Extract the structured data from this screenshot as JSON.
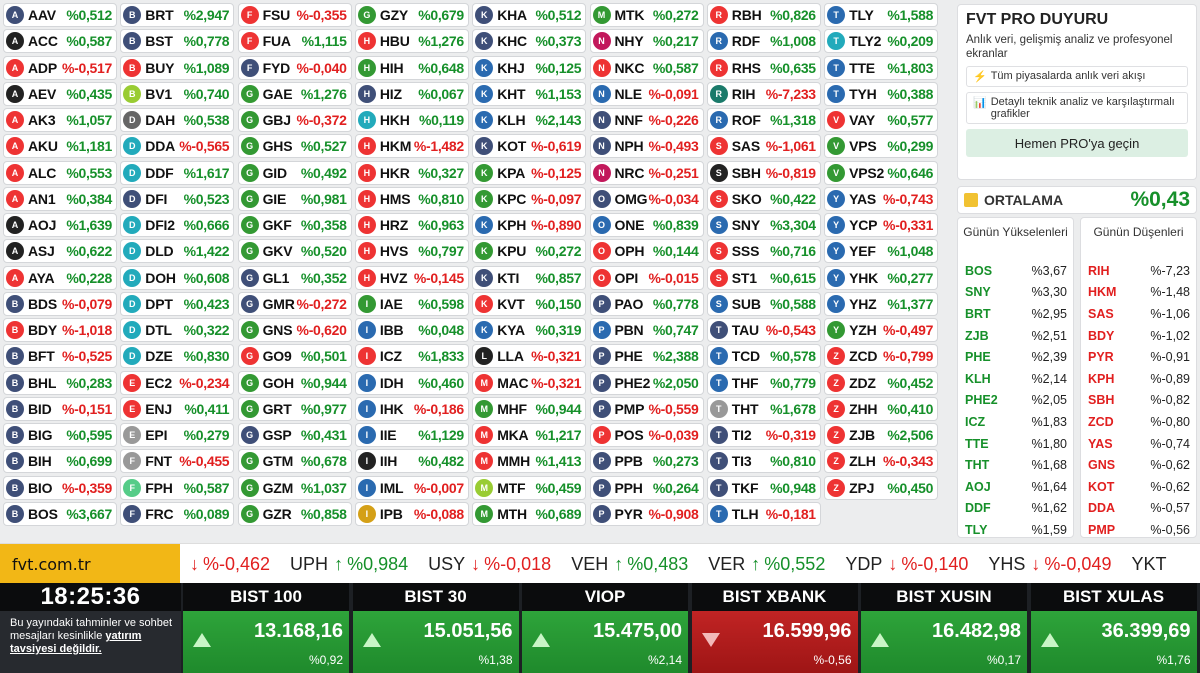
{
  "stocks": [
    [
      [
        "AAV",
        "%0,512",
        "up",
        "#3f4f78"
      ],
      [
        "ACC",
        "%0,587",
        "up",
        "#222"
      ],
      [
        "ADP",
        "%-0,517",
        "dn",
        "#e33"
      ],
      [
        "AEV",
        "%0,435",
        "up",
        "#222"
      ],
      [
        "AK3",
        "%1,057",
        "up",
        "#e33"
      ],
      [
        "AKU",
        "%1,181",
        "up",
        "#e33"
      ],
      [
        "ALC",
        "%0,553",
        "up",
        "#e33"
      ],
      [
        "AN1",
        "%0,384",
        "up",
        "#e33"
      ],
      [
        "AOJ",
        "%1,639",
        "up",
        "#222"
      ],
      [
        "ASJ",
        "%0,622",
        "up",
        "#222"
      ],
      [
        "AYA",
        "%0,228",
        "up",
        "#e33"
      ],
      [
        "BDS",
        "%-0,079",
        "dn",
        "#3f4f78"
      ],
      [
        "BDY",
        "%-1,018",
        "dn",
        "#e33"
      ],
      [
        "BFT",
        "%-0,525",
        "dn",
        "#3f4f78"
      ],
      [
        "BHL",
        "%0,283",
        "up",
        "#3f4f78"
      ],
      [
        "BID",
        "%-0,151",
        "dn",
        "#3f4f78"
      ],
      [
        "BIG",
        "%0,595",
        "up",
        "#3f4f78"
      ],
      [
        "BIH",
        "%0,699",
        "up",
        "#3f4f78"
      ],
      [
        "BIO",
        "%-0,359",
        "dn",
        "#3f4f78"
      ],
      [
        "BOS",
        "%3,667",
        "up",
        "#3f4f78"
      ]
    ],
    [
      [
        "BRT",
        "%2,947",
        "up",
        "#3f4f78"
      ],
      [
        "BST",
        "%0,778",
        "up",
        "#3f4f78"
      ],
      [
        "BUY",
        "%1,089",
        "up",
        "#e33"
      ],
      [
        "BV1",
        "%0,740",
        "up",
        "#9c3"
      ],
      [
        "DAH",
        "%0,538",
        "up",
        "#666"
      ],
      [
        "DDA",
        "%-0,565",
        "dn",
        "#2ab"
      ],
      [
        "DDF",
        "%1,617",
        "up",
        "#2ab"
      ],
      [
        "DFI",
        "%0,523",
        "up",
        "#3f4f78"
      ],
      [
        "DFI2",
        "%0,666",
        "up",
        "#2ab"
      ],
      [
        "DLD",
        "%1,422",
        "up",
        "#2ab"
      ],
      [
        "DOH",
        "%0,608",
        "up",
        "#2ab"
      ],
      [
        "DPT",
        "%0,423",
        "up",
        "#2ab"
      ],
      [
        "DTL",
        "%0,322",
        "up",
        "#2ab"
      ],
      [
        "DZE",
        "%0,830",
        "up",
        "#2ab"
      ],
      [
        "EC2",
        "%-0,234",
        "dn",
        "#e33"
      ],
      [
        "ENJ",
        "%0,411",
        "up",
        "#e33"
      ],
      [
        "EPI",
        "%0,279",
        "up",
        "#999"
      ],
      [
        "FNT",
        "%-0,455",
        "dn",
        "#999"
      ],
      [
        "FPH",
        "%0,587",
        "up",
        "#5c8"
      ],
      [
        "FRC",
        "%0,089",
        "up",
        "#3f4f78"
      ]
    ],
    [
      [
        "FSU",
        "%-0,355",
        "dn",
        "#e33"
      ],
      [
        "FUA",
        "%1,115",
        "up",
        "#e33"
      ],
      [
        "FYD",
        "%-0,040",
        "dn",
        "#3f4f78"
      ],
      [
        "GAE",
        "%1,276",
        "up",
        "#393"
      ],
      [
        "GBJ",
        "%-0,372",
        "dn",
        "#393"
      ],
      [
        "GHS",
        "%0,527",
        "up",
        "#393"
      ],
      [
        "GID",
        "%0,492",
        "up",
        "#393"
      ],
      [
        "GIE",
        "%0,981",
        "up",
        "#393"
      ],
      [
        "GKF",
        "%0,358",
        "up",
        "#393"
      ],
      [
        "GKV",
        "%0,520",
        "up",
        "#393"
      ],
      [
        "GL1",
        "%0,352",
        "up",
        "#3f4f78"
      ],
      [
        "GMR",
        "%-0,272",
        "dn",
        "#3f4f78"
      ],
      [
        "GNS",
        "%-0,620",
        "dn",
        "#393"
      ],
      [
        "GO9",
        "%0,501",
        "up",
        "#e33"
      ],
      [
        "GOH",
        "%0,944",
        "up",
        "#393"
      ],
      [
        "GRT",
        "%0,977",
        "up",
        "#393"
      ],
      [
        "GSP",
        "%0,431",
        "up",
        "#3f4f78"
      ],
      [
        "GTM",
        "%0,678",
        "up",
        "#393"
      ],
      [
        "GZM",
        "%1,037",
        "up",
        "#393"
      ],
      [
        "GZR",
        "%0,858",
        "up",
        "#393"
      ]
    ],
    [
      [
        "GZY",
        "%0,679",
        "up",
        "#393"
      ],
      [
        "HBU",
        "%1,276",
        "up",
        "#e33"
      ],
      [
        "HIH",
        "%0,648",
        "up",
        "#393"
      ],
      [
        "HIZ",
        "%0,067",
        "up",
        "#3f4f78"
      ],
      [
        "HKH",
        "%0,119",
        "up",
        "#2ab"
      ],
      [
        "HKM",
        "%-1,482",
        "dn",
        "#e33"
      ],
      [
        "HKR",
        "%0,327",
        "up",
        "#e33"
      ],
      [
        "HMS",
        "%0,810",
        "up",
        "#e33"
      ],
      [
        "HRZ",
        "%0,963",
        "up",
        "#e33"
      ],
      [
        "HVS",
        "%0,797",
        "up",
        "#e33"
      ],
      [
        "HVZ",
        "%-0,145",
        "dn",
        "#e33"
      ],
      [
        "IAE",
        "%0,598",
        "up",
        "#393"
      ],
      [
        "IBB",
        "%0,048",
        "up",
        "#2a6ab0"
      ],
      [
        "ICZ",
        "%1,833",
        "up",
        "#e33"
      ],
      [
        "IDH",
        "%0,460",
        "up",
        "#2a6ab0"
      ],
      [
        "IHK",
        "%-0,186",
        "dn",
        "#2a6ab0"
      ],
      [
        "IIE",
        "%1,129",
        "up",
        "#2a6ab0"
      ],
      [
        "IIH",
        "%0,482",
        "up",
        "#222"
      ],
      [
        "IML",
        "%-0,007",
        "dn",
        "#2a6ab0"
      ],
      [
        "IPB",
        "%-0,088",
        "dn",
        "#d4a017"
      ]
    ],
    [
      [
        "KHA",
        "%0,512",
        "up",
        "#3f4f78"
      ],
      [
        "KHC",
        "%0,373",
        "up",
        "#3f4f78"
      ],
      [
        "KHJ",
        "%0,125",
        "up",
        "#2a6ab0"
      ],
      [
        "KHT",
        "%1,153",
        "up",
        "#2a6ab0"
      ],
      [
        "KLH",
        "%2,143",
        "up",
        "#2a6ab0"
      ],
      [
        "KOT",
        "%-0,619",
        "dn",
        "#3f4f78"
      ],
      [
        "KPA",
        "%-0,125",
        "dn",
        "#393"
      ],
      [
        "KPC",
        "%-0,097",
        "dn",
        "#393"
      ],
      [
        "KPH",
        "%-0,890",
        "dn",
        "#2a6ab0"
      ],
      [
        "KPU",
        "%0,272",
        "up",
        "#393"
      ],
      [
        "KTI",
        "%0,857",
        "up",
        "#3f4f78"
      ],
      [
        "KVT",
        "%0,150",
        "up",
        "#e33"
      ],
      [
        "KYA",
        "%0,319",
        "up",
        "#2a6ab0"
      ],
      [
        "LLA",
        "%-0,321",
        "dn",
        "#222"
      ],
      [
        "MAC",
        "%-0,321",
        "dn",
        "#e33"
      ],
      [
        "MHF",
        "%0,944",
        "up",
        "#393"
      ],
      [
        "MKA",
        "%1,217",
        "up",
        "#e33"
      ],
      [
        "MMH",
        "%1,413",
        "up",
        "#e33"
      ],
      [
        "MTF",
        "%0,459",
        "up",
        "#9c3"
      ],
      [
        "MTH",
        "%0,689",
        "up",
        "#393"
      ]
    ],
    [
      [
        "MTK",
        "%0,272",
        "up",
        "#393"
      ],
      [
        "NHY",
        "%0,217",
        "up",
        "#c2185b"
      ],
      [
        "NKC",
        "%0,587",
        "up",
        "#e33"
      ],
      [
        "NLE",
        "%-0,091",
        "dn",
        "#2a6ab0"
      ],
      [
        "NNF",
        "%-0,226",
        "dn",
        "#3f4f78"
      ],
      [
        "NPH",
        "%-0,493",
        "dn",
        "#3f4f78"
      ],
      [
        "NRC",
        "%-0,251",
        "dn",
        "#c2185b"
      ],
      [
        "OMG",
        "%-0,034",
        "dn",
        "#3f4f78"
      ],
      [
        "ONE",
        "%0,839",
        "up",
        "#2a6ab0"
      ],
      [
        "OPH",
        "%0,144",
        "up",
        "#e33"
      ],
      [
        "OPI",
        "%-0,015",
        "dn",
        "#e33"
      ],
      [
        "PAO",
        "%0,778",
        "up",
        "#3f4f78"
      ],
      [
        "PBN",
        "%0,747",
        "up",
        "#2a6ab0"
      ],
      [
        "PHE",
        "%2,388",
        "up",
        "#3f4f78"
      ],
      [
        "PHE2",
        "%2,050",
        "up",
        "#3f4f78"
      ],
      [
        "PMP",
        "%-0,559",
        "dn",
        "#3f4f78"
      ],
      [
        "POS",
        "%-0,039",
        "dn",
        "#e33"
      ],
      [
        "PPB",
        "%0,273",
        "up",
        "#3f4f78"
      ],
      [
        "PPH",
        "%0,264",
        "up",
        "#3f4f78"
      ],
      [
        "PYR",
        "%-0,908",
        "dn",
        "#3f4f78"
      ]
    ],
    [
      [
        "RBH",
        "%0,826",
        "up",
        "#e33"
      ],
      [
        "RDF",
        "%1,008",
        "up",
        "#2a6ab0"
      ],
      [
        "RHS",
        "%0,635",
        "up",
        "#e33"
      ],
      [
        "RIH",
        "%-7,233",
        "dn",
        "#1a7a6a"
      ],
      [
        "ROF",
        "%1,318",
        "up",
        "#2a6ab0"
      ],
      [
        "SAS",
        "%-1,061",
        "dn",
        "#e33"
      ],
      [
        "SBH",
        "%-0,819",
        "dn",
        "#222"
      ],
      [
        "SKO",
        "%0,422",
        "up",
        "#e33"
      ],
      [
        "SNY",
        "%3,304",
        "up",
        "#2a6ab0"
      ],
      [
        "SSS",
        "%0,716",
        "up",
        "#e33"
      ],
      [
        "ST1",
        "%0,615",
        "up",
        "#e33"
      ],
      [
        "SUB",
        "%0,588",
        "up",
        "#2a6ab0"
      ],
      [
        "TAU",
        "%-0,543",
        "dn",
        "#3f4f78"
      ],
      [
        "TCD",
        "%0,578",
        "up",
        "#2a6ab0"
      ],
      [
        "THF",
        "%0,779",
        "up",
        "#2a6ab0"
      ],
      [
        "THT",
        "%1,678",
        "up",
        "#999"
      ],
      [
        "TI2",
        "%-0,319",
        "dn",
        "#3f4f78"
      ],
      [
        "TI3",
        "%0,810",
        "up",
        "#3f4f78"
      ],
      [
        "TKF",
        "%0,948",
        "up",
        "#3f4f78"
      ],
      [
        "TLH",
        "%-0,181",
        "dn",
        "#2a6ab0"
      ]
    ],
    [
      [
        "TLY",
        "%1,588",
        "up",
        "#2a6ab0"
      ],
      [
        "TLY2",
        "%0,209",
        "up",
        "#2ab"
      ],
      [
        "TTE",
        "%1,803",
        "up",
        "#2a6ab0"
      ],
      [
        "TYH",
        "%0,388",
        "up",
        "#2a6ab0"
      ],
      [
        "VAY",
        "%0,577",
        "up",
        "#e33"
      ],
      [
        "VPS",
        "%0,299",
        "up",
        "#393"
      ],
      [
        "VPS2",
        "%0,646",
        "up",
        "#393"
      ],
      [
        "YAS",
        "%-0,743",
        "dn",
        "#2a6ab0"
      ],
      [
        "YCP",
        "%-0,331",
        "dn",
        "#2a6ab0"
      ],
      [
        "YEF",
        "%1,048",
        "up",
        "#2a6ab0"
      ],
      [
        "YHK",
        "%0,277",
        "up",
        "#2a6ab0"
      ],
      [
        "YHZ",
        "%1,377",
        "up",
        "#2a6ab0"
      ],
      [
        "YZH",
        "%-0,497",
        "dn",
        "#393"
      ],
      [
        "ZCD",
        "%-0,799",
        "dn",
        "#e33"
      ],
      [
        "ZDZ",
        "%0,452",
        "up",
        "#e33"
      ],
      [
        "ZHH",
        "%0,410",
        "up",
        "#e33"
      ],
      [
        "ZJB",
        "%2,506",
        "up",
        "#e33"
      ],
      [
        "ZLH",
        "%-0,343",
        "dn",
        "#e33"
      ],
      [
        "ZPJ",
        "%0,450",
        "up",
        "#e33"
      ]
    ]
  ],
  "pro": {
    "title": "FVT PRO DUYURU",
    "subtitle": "Anlık veri, gelişmiş analiz ve profesyonel ekranlar",
    "feature1": "Tüm piyasalarda anlık veri akışı",
    "feature2": "Detaylı teknik analiz ve karşılaştırmalı grafikler",
    "button": "Hemen PRO'ya geçin"
  },
  "average": {
    "label": "ORTALAMA",
    "value": "%0,43"
  },
  "gainers": {
    "title": "Günün Yükselenleri",
    "rows": [
      [
        "BOS",
        "%3,67"
      ],
      [
        "SNY",
        "%3,30"
      ],
      [
        "BRT",
        "%2,95"
      ],
      [
        "ZJB",
        "%2,51"
      ],
      [
        "PHE",
        "%2,39"
      ],
      [
        "KLH",
        "%2,14"
      ],
      [
        "PHE2",
        "%2,05"
      ],
      [
        "ICZ",
        "%1,83"
      ],
      [
        "TTE",
        "%1,80"
      ],
      [
        "THT",
        "%1,68"
      ],
      [
        "AOJ",
        "%1,64"
      ],
      [
        "DDF",
        "%1,62"
      ],
      [
        "TLY",
        "%1,59"
      ]
    ]
  },
  "losers": {
    "title": "Günün Düşenleri",
    "rows": [
      [
        "RIH",
        "%-7,23"
      ],
      [
        "HKM",
        "%-1,48"
      ],
      [
        "SAS",
        "%-1,06"
      ],
      [
        "BDY",
        "%-1,02"
      ],
      [
        "PYR",
        "%-0,91"
      ],
      [
        "KPH",
        "%-0,89"
      ],
      [
        "SBH",
        "%-0,82"
      ],
      [
        "ZCD",
        "%-0,80"
      ],
      [
        "YAS",
        "%-0,74"
      ],
      [
        "GNS",
        "%-0,62"
      ],
      [
        "KOT",
        "%-0,62"
      ],
      [
        "DDA",
        "%-0,57"
      ],
      [
        "PMP",
        "%-0,56"
      ]
    ]
  },
  "ticker": {
    "site": "fvt.com.tr",
    "items": [
      [
        "",
        "%-0,462",
        "dn"
      ],
      [
        "UPH",
        "%0,984",
        "up"
      ],
      [
        "USY",
        "%-0,018",
        "dn"
      ],
      [
        "VEH",
        "%0,483",
        "up"
      ],
      [
        "VER",
        "%0,552",
        "up"
      ],
      [
        "YDP",
        "%-0,140",
        "dn"
      ],
      [
        "YHS",
        "%-0,049",
        "dn"
      ],
      [
        "YKT",
        "",
        ""
      ]
    ]
  },
  "clock": {
    "time": "18:25:36",
    "disclaimer": "Bu yayındaki tahminler ve sohbet mesajları kesinlikle",
    "disclaimer_bold": "yatırım tavsiyesi değildir."
  },
  "indices": [
    {
      "name": "BIST 100",
      "value": "13.168,16",
      "change": "%0,92",
      "dir": "up"
    },
    {
      "name": "BIST 30",
      "value": "15.051,56",
      "change": "%1,38",
      "dir": "up"
    },
    {
      "name": "VIOP",
      "value": "15.475,00",
      "change": "%2,14",
      "dir": "up"
    },
    {
      "name": "BIST XBANK",
      "value": "16.599,96",
      "change": "%-0,56",
      "dir": "dn"
    },
    {
      "name": "BIST XUSIN",
      "value": "16.482,98",
      "change": "%0,17",
      "dir": "up"
    },
    {
      "name": "BIST XULAS",
      "value": "36.399,69",
      "change": "%1,76",
      "dir": "up"
    }
  ]
}
